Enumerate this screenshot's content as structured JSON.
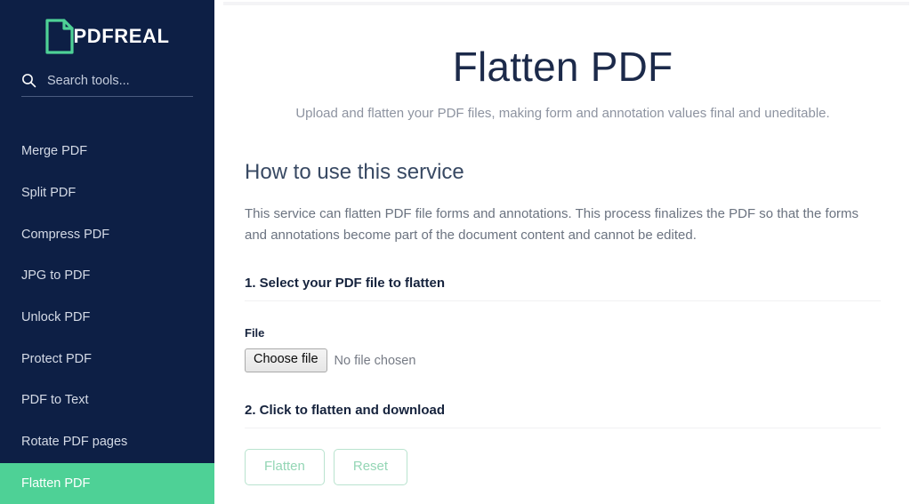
{
  "brand": {
    "name": "PDFREAL",
    "logo_icon": "document-fold-icon"
  },
  "search": {
    "placeholder": "Search tools...",
    "value": "",
    "icon": "search-icon"
  },
  "sidebar": {
    "items": [
      {
        "label": "Merge PDF",
        "active": false
      },
      {
        "label": "Split PDF",
        "active": false
      },
      {
        "label": "Compress PDF",
        "active": false
      },
      {
        "label": "JPG to PDF",
        "active": false
      },
      {
        "label": "Unlock PDF",
        "active": false
      },
      {
        "label": "Protect PDF",
        "active": false
      },
      {
        "label": "PDF to Text",
        "active": false
      },
      {
        "label": "Rotate PDF pages",
        "active": false
      },
      {
        "label": "Flatten PDF",
        "active": true
      }
    ]
  },
  "main": {
    "title": "Flatten PDF",
    "subtitle": "Upload and flatten your PDF files, making form and annotation values final and uneditable.",
    "how_to": {
      "heading": "How to use this service",
      "description": "This service can flatten PDF file forms and annotations. This process finalizes the PDF so that the forms and annotations become part of the document content and cannot be edited."
    },
    "step1": {
      "title": "1. Select your PDF file to flatten",
      "file_label": "File",
      "choose_file_button": "Choose file",
      "no_file_text": "No file chosen"
    },
    "step2": {
      "title": "2. Click to flatten and download",
      "flatten_button": "Flatten",
      "reset_button": "Reset"
    }
  },
  "colors": {
    "sidebar_bg": "#0d1f45",
    "accent_green": "#4ed196",
    "title_navy": "#1c2a4a",
    "button_border_green": "#b9e3cf",
    "button_text_green": "#94d6b5"
  }
}
